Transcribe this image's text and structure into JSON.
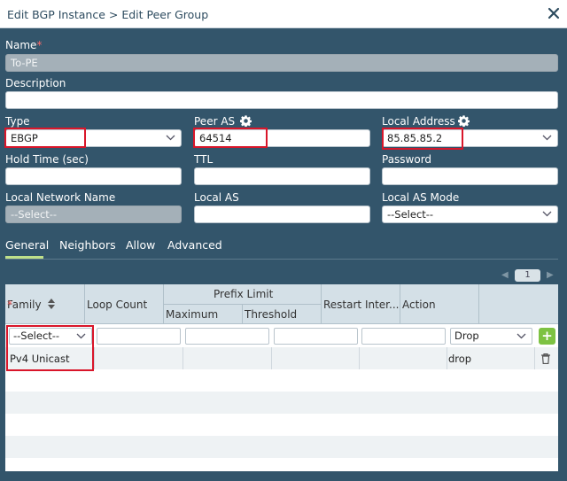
{
  "dialog": {
    "title": "Edit BGP Instance > Edit Peer Group"
  },
  "form": {
    "name": {
      "label": "Name",
      "required_mark": "*",
      "value": "To-PE"
    },
    "description": {
      "label": "Description",
      "value": ""
    },
    "type": {
      "label": "Type",
      "value": "EBGP"
    },
    "peer_as": {
      "label": "Peer AS",
      "value": "64514"
    },
    "local_address": {
      "label": "Local Address",
      "value": "85.85.85.2"
    },
    "hold_time": {
      "label": "Hold Time (sec)",
      "value": ""
    },
    "ttl": {
      "label": "TTL",
      "value": ""
    },
    "password": {
      "label": "Password",
      "value": ""
    },
    "local_network_name": {
      "label": "Local Network Name",
      "value": "--Select--"
    },
    "local_as": {
      "label": "Local AS",
      "value": ""
    },
    "local_as_mode": {
      "label": "Local AS Mode",
      "value": "--Select--"
    }
  },
  "tabs": [
    "General",
    "Neighbors",
    "Allow",
    "Advanced"
  ],
  "active_tab": "General",
  "pager": {
    "page": "1"
  },
  "table": {
    "headers": {
      "family": "Family",
      "family_required": "*",
      "loop_count": "Loop Count",
      "prefix_limit": "Prefix Limit",
      "maximum": "Maximum",
      "threshold": "Threshold",
      "restart_interval": "Restart Inter...",
      "action": "Action"
    },
    "input_row": {
      "family": "--Select--",
      "loop_count": "",
      "maximum": "",
      "threshold": "",
      "restart_interval": "",
      "action": "Drop",
      "add_label": "+"
    },
    "rows": [
      {
        "family": "Pv4 Unicast",
        "loop_count": "",
        "maximum": "",
        "threshold": "",
        "restart_interval": "",
        "action": "drop"
      }
    ]
  },
  "colors": {
    "background": "#33556b",
    "highlight": "#d9162a",
    "active_tab": "#bfe08a",
    "add_button": "#7dc242",
    "header_bg": "#d4e0e7"
  },
  "icons": [
    "close-icon",
    "gear-icon",
    "chevron-down-icon",
    "sort-icon",
    "plus-icon",
    "trash-icon"
  ]
}
